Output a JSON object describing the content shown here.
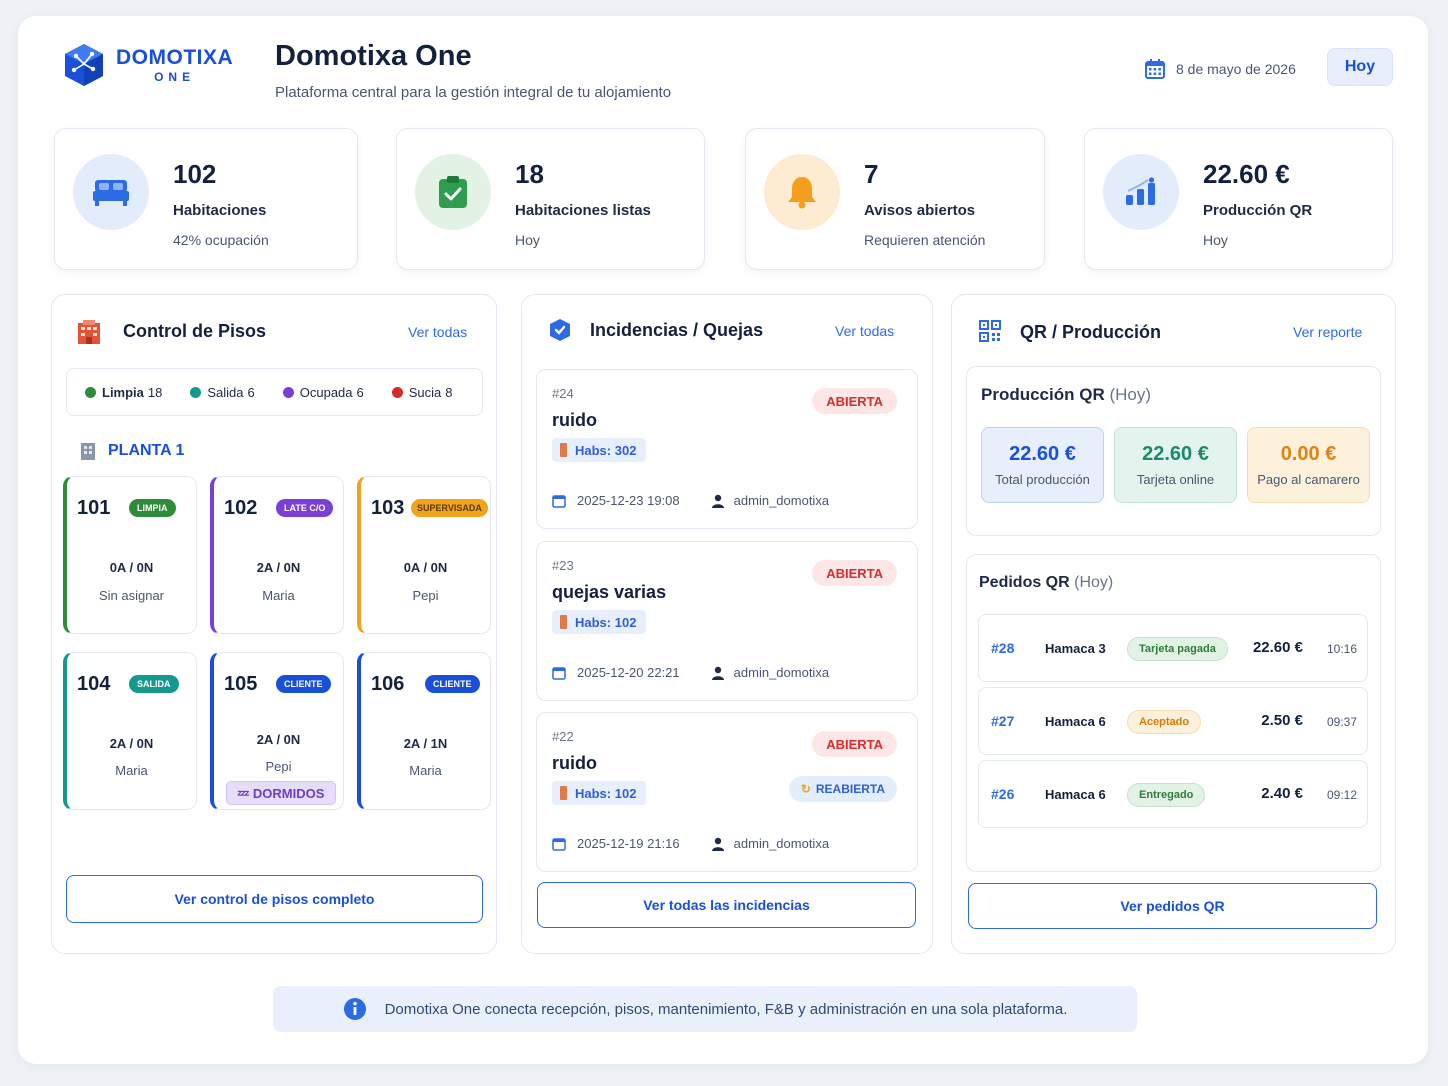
{
  "brand": {
    "line1": "DOMOTIXA",
    "line2": "ONE"
  },
  "header": {
    "title": "Domotixa One",
    "subtitle": "Plataforma central para la gestión integral de tu alojamiento",
    "date": "8 de mayo de 2026",
    "today_button": "Hoy"
  },
  "stats": [
    {
      "value": "102",
      "label": "Habitaciones",
      "sub": "42% ocupación",
      "icon": "bed-icon",
      "color": "#2d6be4"
    },
    {
      "value": "18",
      "label": "Habitaciones listas",
      "sub": "Hoy",
      "icon": "clipboard-check-icon",
      "color": "#2e9d4f"
    },
    {
      "value": "7",
      "label": "Avisos abiertos",
      "sub": "Requieren atención",
      "icon": "bell-icon",
      "color": "#f59e1b"
    },
    {
      "value": "22.60 €",
      "label": "Producción QR",
      "sub": "Hoy",
      "icon": "bar-chart-icon",
      "color": "#2d6be4"
    }
  ],
  "floors": {
    "title": "Control de Pisos",
    "link": "Ver todas",
    "legend": [
      {
        "label": "Limpia",
        "count": "18",
        "color": "#2e8b3a"
      },
      {
        "label": "Salida",
        "count": "6",
        "color": "#15998f"
      },
      {
        "label": "Ocupada",
        "count": "6",
        "color": "#7b3fd6"
      },
      {
        "label": "Sucia",
        "count": "8",
        "color": "#d62b2b"
      }
    ],
    "plant": "PLANTA 1",
    "rooms": [
      {
        "number": "101",
        "tag": "LIMPIA",
        "occupancy": "0A / 0N",
        "assigned": "Sin asignar",
        "color": "#2e8b3a"
      },
      {
        "number": "102",
        "tag": "LATE C/O",
        "occupancy": "2A / 0N",
        "assigned": "Maria",
        "color": "#7b3fd6"
      },
      {
        "number": "103",
        "tag": "SUPERVISADA",
        "occupancy": "0A / 0N",
        "assigned": "Pepi",
        "color": "#f2a31c"
      },
      {
        "number": "104",
        "tag": "SALIDA",
        "occupancy": "2A / 0N",
        "assigned": "Maria",
        "color": "#15998f"
      },
      {
        "number": "105",
        "tag": "CLIENTE",
        "occupancy": "2A / 0N",
        "assigned": "Pepi",
        "color": "#1a4fd8",
        "extra": "DORMIDOS"
      },
      {
        "number": "106",
        "tag": "CLIENTE",
        "occupancy": "2A / 1N",
        "assigned": "Maria",
        "color": "#1a4fd8"
      }
    ],
    "button": "Ver control de pisos completo"
  },
  "incidents": {
    "title": "Incidencias / Quejas",
    "link": "Ver todas",
    "items": [
      {
        "id": "#24",
        "title": "ruido",
        "room": "Habs: 302",
        "status": "ABIERTA",
        "date": "2025-12-23 19:08",
        "user": "admin_domotixa"
      },
      {
        "id": "#23",
        "title": "quejas varias",
        "room": "Habs: 102",
        "status": "ABIERTA",
        "date": "2025-12-20 22:21",
        "user": "admin_domotixa"
      },
      {
        "id": "#22",
        "title": "ruido",
        "room": "Habs: 102",
        "status": "ABIERTA",
        "extra": "REABIERTA",
        "date": "2025-12-19 21:16",
        "user": "admin_domotixa"
      }
    ],
    "button": "Ver todas las incidencias"
  },
  "qr": {
    "title": "QR / Producción",
    "link": "Ver reporte",
    "production_title": "Producción QR",
    "production_suffix": "(Hoy)",
    "kpis": [
      {
        "value": "22.60 €",
        "label": "Total producción",
        "color": "#1a4fd8"
      },
      {
        "value": "22.60 €",
        "label": "Tarjeta online",
        "color": "#1b8a6b"
      },
      {
        "value": "0.00 €",
        "label": "Pago al camarero",
        "color": "#e0820f"
      }
    ],
    "orders_title": "Pedidos QR",
    "orders_suffix": "(Hoy)",
    "orders": [
      {
        "id": "#28",
        "location": "Hamaca 3",
        "status": "Tarjeta pagada",
        "amount": "22.60 €",
        "time": "10:16"
      },
      {
        "id": "#27",
        "location": "Hamaca 6",
        "status": "Aceptado",
        "amount": "2.50 €",
        "time": "09:37"
      },
      {
        "id": "#26",
        "location": "Hamaca 6",
        "status": "Entregado",
        "amount": "2.40 €",
        "time": "09:12"
      }
    ],
    "button": "Ver pedidos QR"
  },
  "footer": {
    "info": "Domotixa One conecta recepción, pisos, mantenimiento, F&B y administración en una sola plataforma."
  }
}
